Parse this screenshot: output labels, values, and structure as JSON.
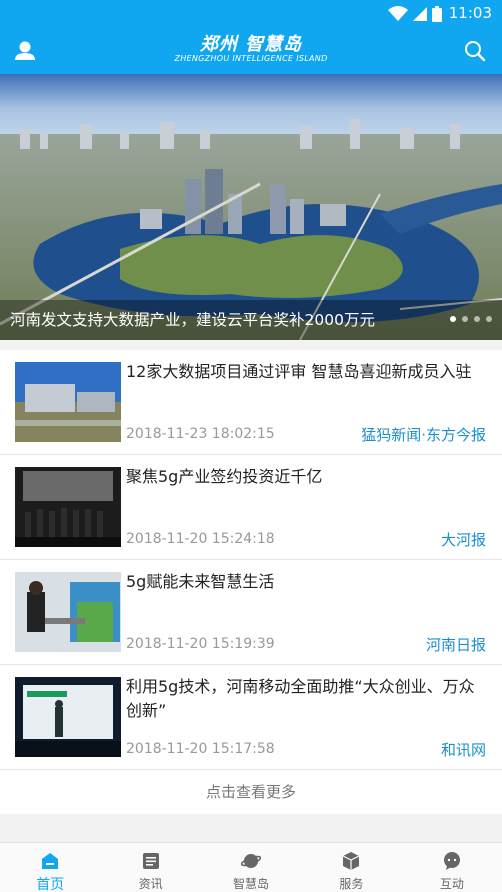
{
  "status_bar": {
    "time": "11:03",
    "icons": [
      "wifi-icon",
      "signal-icon",
      "battery-icon"
    ]
  },
  "header": {
    "title": "郑州 智慧岛",
    "subtitle": "ZHENGZHOU INTELLIGENCE ISLAND",
    "left_icon": "user-icon",
    "right_icon": "search-icon",
    "bg_color": "#10a7f0"
  },
  "banner": {
    "caption": "河南发文支持大数据产业，建设云平台奖补2000万元",
    "dots": 4,
    "active_dot": 0
  },
  "news": [
    {
      "headline": "12家大数据项目通过评审 智慧岛喜迎新成员入驻",
      "date": "2018-11-23 18:02:15",
      "source": "猛犸新闻·东方今报"
    },
    {
      "headline": "聚焦5g产业签约投资近千亿",
      "date": "2018-11-20 15:24:18",
      "source": "大河报"
    },
    {
      "headline": "5g赋能未来智慧生活",
      "date": "2018-11-20 15:19:39",
      "source": "河南日报"
    },
    {
      "headline": "利用5g技术，河南移动全面助推“大众创业、万众创新”",
      "date": "2018-11-20 15:17:58",
      "source": "和讯网"
    }
  ],
  "load_more": "点击查看更多",
  "tabs": [
    {
      "label": "首页",
      "icon": "home-icon",
      "active": true
    },
    {
      "label": "资讯",
      "icon": "news-icon",
      "active": false
    },
    {
      "label": "智慧岛",
      "icon": "planet-icon",
      "active": false
    },
    {
      "label": "服务",
      "icon": "cube-icon",
      "active": false
    },
    {
      "label": "互动",
      "icon": "chat-icon",
      "active": false
    }
  ],
  "colors": {
    "accent": "#10a7f0",
    "source_link": "#1a8fd0"
  }
}
